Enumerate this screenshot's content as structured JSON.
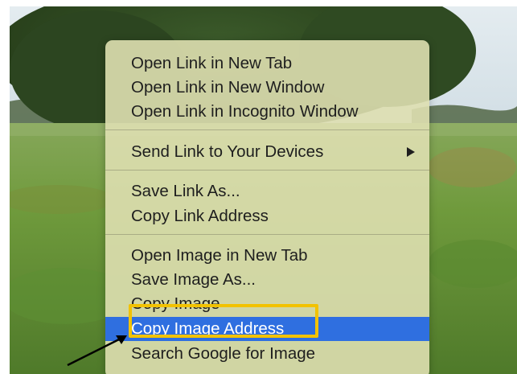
{
  "background": {
    "description_icon": "landscape-photo",
    "sky_color": "#d7e3ea",
    "tree_color": "#2f4a22",
    "grass_color": "#6f9a3c"
  },
  "context_menu": {
    "groups": [
      {
        "items": [
          {
            "label": "Open Link in New Tab"
          },
          {
            "label": "Open Link in New Window"
          },
          {
            "label": "Open Link in Incognito Window"
          }
        ]
      },
      {
        "items": [
          {
            "label": "Send Link to Your Devices",
            "submenu_icon": "triangle-right-icon"
          }
        ]
      },
      {
        "items": [
          {
            "label": "Save Link As..."
          },
          {
            "label": "Copy Link Address"
          }
        ]
      },
      {
        "items": [
          {
            "label": "Open Image in New Tab"
          },
          {
            "label": "Save Image As..."
          },
          {
            "label": "Copy Image"
          },
          {
            "label": "Copy Image Address",
            "highlighted": true
          },
          {
            "label": "Search Google for Image"
          }
        ]
      }
    ],
    "highlight_color": "#2f6fe0",
    "annotation_box_color": "#f2c200",
    "annotation_arrow_icon": "pointer-arrow-icon"
  }
}
